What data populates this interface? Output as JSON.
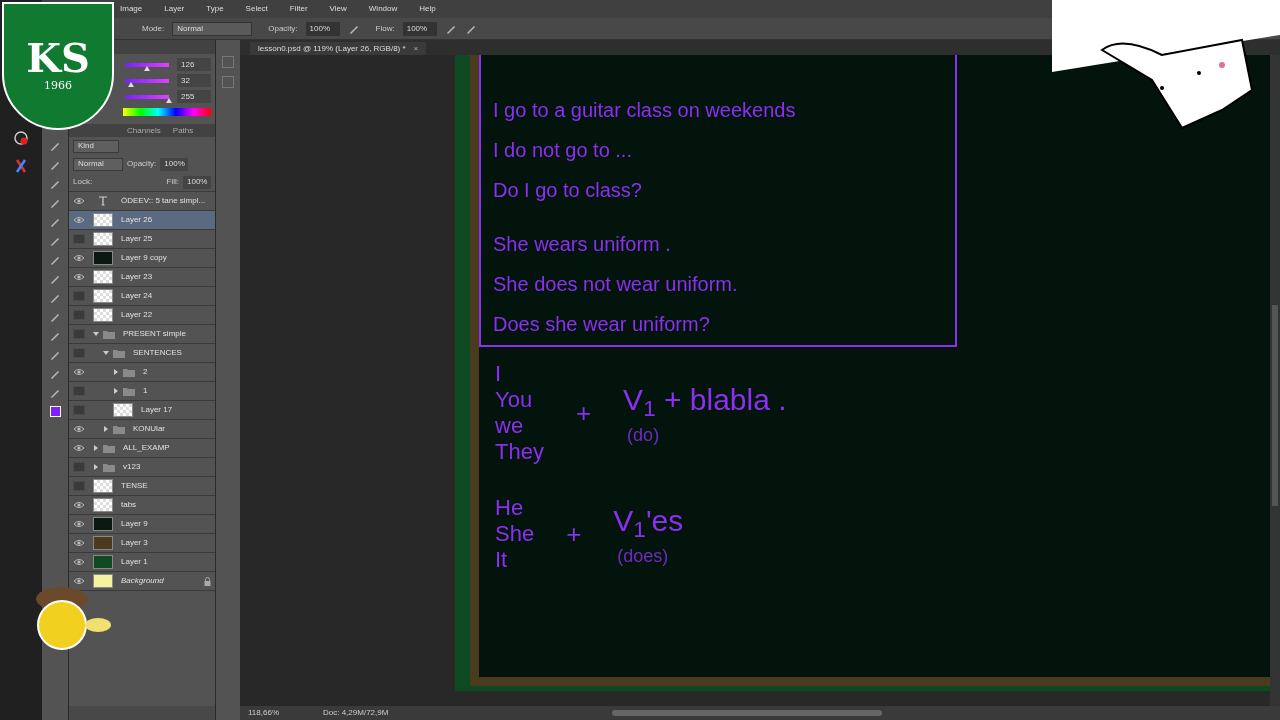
{
  "crest": {
    "letters": "KS",
    "year": "1966"
  },
  "menu": [
    "Image",
    "Layer",
    "Type",
    "Select",
    "Filter",
    "View",
    "Window",
    "Help"
  ],
  "options": {
    "mode_label": "Mode:",
    "mode": "Normal",
    "opacity_label": "Opacity:",
    "opacity": "100%",
    "flow_label": "Flow:",
    "flow": "100%"
  },
  "color_panel": {
    "sliders": [
      {
        "value": "126",
        "level": 0.49
      },
      {
        "value": "32",
        "level": 0.13
      },
      {
        "value": "255",
        "level": 1
      }
    ]
  },
  "layers_panel": {
    "tabs": [
      {
        "label": "Channels",
        "selected": false
      },
      {
        "label": "Paths",
        "selected": false
      }
    ],
    "filter": "Kind",
    "blend": "Normal",
    "opacity_label": "Opacity:",
    "opacity": "100%",
    "lock_label": "Lock:",
    "fill_label": "Fill:",
    "fill": "100%",
    "layers": [
      {
        "kind": "text",
        "name": "ÖDEEV::  5 tane simpl...",
        "visible": true,
        "selected": false
      },
      {
        "kind": "layer",
        "name": "Layer 26",
        "visible": true,
        "selected": true
      },
      {
        "kind": "layer",
        "name": "Layer 25",
        "visible": false,
        "selected": false
      },
      {
        "kind": "layer",
        "name": "Layer 9 copy",
        "visible": true,
        "selected": false,
        "color": "#0a1a12"
      },
      {
        "kind": "layer",
        "name": "Layer 23",
        "visible": true,
        "selected": false
      },
      {
        "kind": "layer",
        "name": "Layer 24",
        "visible": false,
        "selected": false
      },
      {
        "kind": "layer",
        "name": "Layer 22",
        "visible": false,
        "selected": false
      },
      {
        "kind": "group",
        "name": "PRESENT simple",
        "visible": false,
        "selected": false,
        "expanded": true,
        "children": [
          {
            "kind": "group",
            "name": "SENTENCES",
            "visible": false,
            "selected": false,
            "expanded": true,
            "children": [
              {
                "kind": "group",
                "name": "2",
                "visible": true,
                "selected": false,
                "expanded": false
              },
              {
                "kind": "group",
                "name": "1",
                "visible": false,
                "selected": false,
                "expanded": false
              },
              {
                "kind": "layer",
                "name": "Layer 17",
                "visible": false,
                "selected": false
              }
            ]
          },
          {
            "kind": "group",
            "name": "KONUlar",
            "visible": true,
            "selected": false,
            "expanded": false
          }
        ]
      },
      {
        "kind": "group",
        "name": "ALL_EXAMP",
        "visible": true,
        "selected": false,
        "expanded": false
      },
      {
        "kind": "group",
        "name": "v123",
        "visible": false,
        "selected": false,
        "expanded": false
      },
      {
        "kind": "layer",
        "name": "TENSE",
        "visible": false,
        "selected": false
      },
      {
        "kind": "layer",
        "name": "tabs",
        "visible": true,
        "selected": false
      },
      {
        "kind": "layer",
        "name": "Layer 9",
        "visible": true,
        "selected": false,
        "color": "#0a1a12"
      },
      {
        "kind": "layer",
        "name": "Layer 3",
        "visible": true,
        "selected": false,
        "color": "#4a3a1e"
      },
      {
        "kind": "layer",
        "name": "Layer 1",
        "visible": true,
        "selected": false,
        "color": "#0f4a22"
      },
      {
        "kind": "layer",
        "name": "Background",
        "visible": true,
        "selected": false,
        "color": "#f4f4a0",
        "locked": true
      }
    ]
  },
  "document_tab": {
    "title": "lesson0.psd @ 119% (Layer 26, RGB/8) *",
    "close": "×"
  },
  "board": {
    "box_lines": [
      "I go to a guitar class on weekends",
      "I do not go to ...",
      "Do I go to class?",
      "She wears uniform .",
      "She does not wear uniform.",
      "Does she wear uniform?"
    ],
    "groups": [
      {
        "pronouns": [
          "I",
          "You",
          "we",
          "They"
        ],
        "plus": "+",
        "formula": "V$_{1}$ + blabla .",
        "hint": "(do)"
      },
      {
        "pronouns": [
          "He",
          "She",
          "It"
        ],
        "plus": "+",
        "formula": "V$_{1}$'es",
        "hint": "(does)"
      }
    ]
  },
  "status_bar": {
    "zoom": "118,66%",
    "doc": "Doc: 4,29M/72,9M"
  }
}
